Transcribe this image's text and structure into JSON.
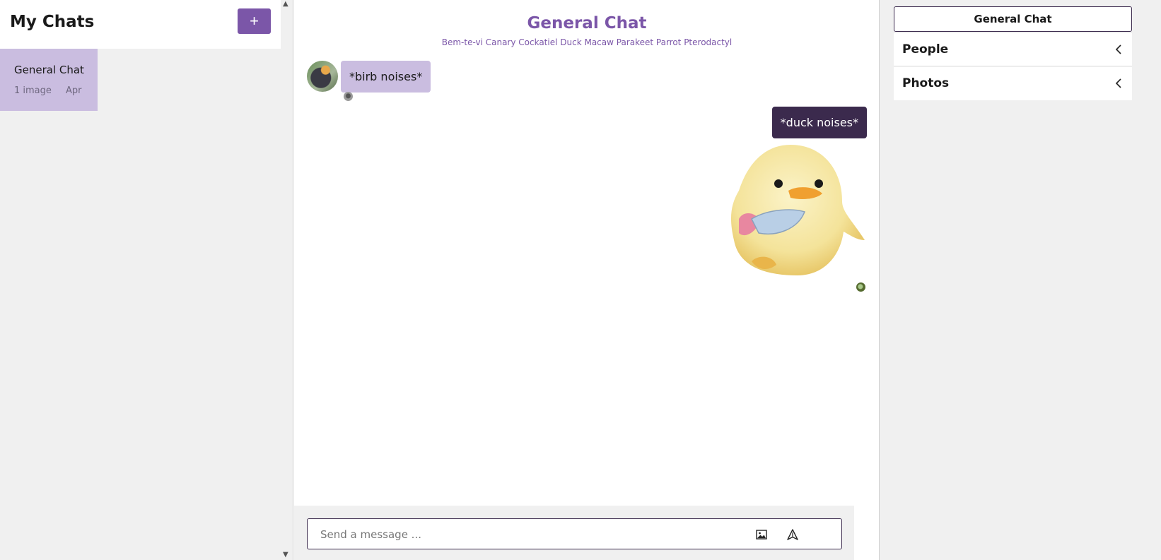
{
  "sidebar": {
    "title": "My Chats",
    "new_chat_label": "+",
    "chats": [
      {
        "name": "General Chat",
        "subtitle": "1 image",
        "date": "Apr"
      }
    ]
  },
  "chat": {
    "title": "General Chat",
    "members": "Bem-te-vi Canary Cockatiel Duck Macaw Parakeet Parrot Pterodactyl",
    "messages": [
      {
        "text": "*birb noises*",
        "side": "left"
      },
      {
        "text": "*duck noises*",
        "side": "right"
      }
    ],
    "composer": {
      "placeholder": "Send a message ..."
    }
  },
  "details": {
    "title": "General Chat",
    "sections": [
      {
        "label": "People"
      },
      {
        "label": "Photos"
      }
    ]
  },
  "colors": {
    "accent": "#7b56a8",
    "selected_chat": "#cabde0",
    "own_bubble": "#3b2a4d",
    "other_bubble": "#cabde0"
  },
  "icons": {
    "image": "image-icon",
    "send": "send-icon",
    "chevron": "chevron-left-icon"
  }
}
